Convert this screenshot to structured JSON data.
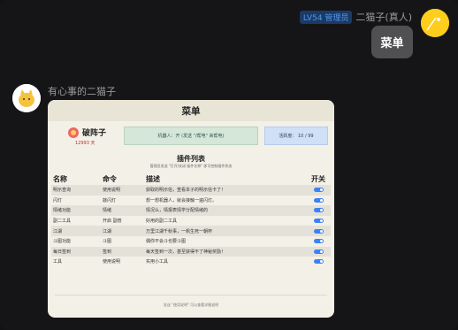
{
  "right_message": {
    "badge": "LV54 管理员",
    "sender": "二猫子(真人)",
    "text": "菜单"
  },
  "left_message": {
    "sender": "有心事的二猫子"
  },
  "card": {
    "title": "菜单",
    "bot_name": "破阵子",
    "bot_sub": "12993 天",
    "status": "机器人：开 (发送 \"/帮电\" 来帮电)",
    "count": "活跃度： 10 / 99",
    "plugin_title": "插件列表",
    "plugin_sub": "管理员发送 \"打开/关闭 插件名称\" 即可控制插件状态",
    "headers": [
      "名称",
      "命令",
      "描述",
      "开关"
    ],
    "rows": [
      [
        "明示查询",
        "使用说明",
        "获取的明示信，查看本子的明示信卡了！"
      ],
      [
        "闪灯",
        "敲闪灯",
        "想一想机器人，就会接触一遍闪灯。"
      ],
      [
        "情绪功能",
        "情绪",
        "情况么，情报表情学分配情绪的"
      ],
      [
        "副二工具",
        "开启 副普",
        "好用的副二工具"
      ],
      [
        "江湖",
        "江湖",
        "万里江湖千秋事，一帆生死一朝杯"
      ],
      [
        "斗图功能",
        "斗图",
        "偶你不会斗也要斗图"
      ],
      [
        "每日签到",
        "签到",
        "每天签到一次，甚至获得不了神秘奖励！"
      ],
      [
        "工具",
        "使用说明",
        "实用小工具"
      ]
    ],
    "footer": "发送 \"使用说明\" 可以查看详细说明"
  }
}
